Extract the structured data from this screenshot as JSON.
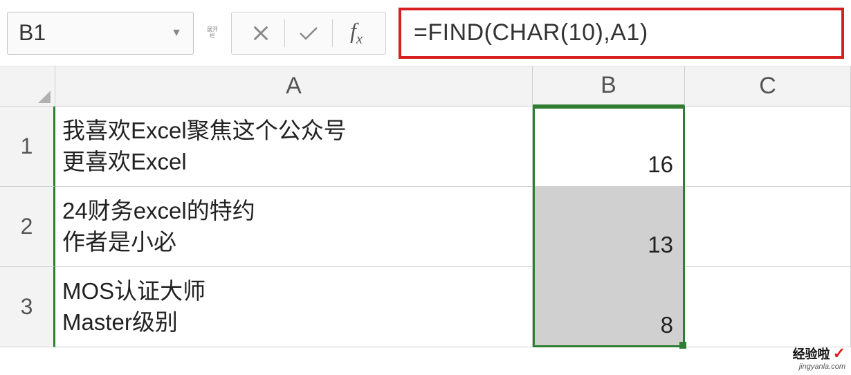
{
  "formula_bar": {
    "name_box": "B1",
    "small_label": "展开栏",
    "formula": "=FIND(CHAR(10),A1)"
  },
  "columns": {
    "a": "A",
    "b": "B",
    "c": "C"
  },
  "rows": {
    "r1": "1",
    "r2": "2",
    "r3": "3"
  },
  "cells": {
    "a1_line1": "我喜欢Excel聚焦这个公众号",
    "a1_line2": "更喜欢Excel",
    "a2_line1": "24财务excel的特约",
    "a2_line2": "作者是小必",
    "a3_line1": "MOS认证大师",
    "a3_line2": "Master级别",
    "b1": "16",
    "b2": "13",
    "b3": "8"
  },
  "watermark": {
    "title": "经验啦",
    "url": "jingyanla.com"
  }
}
